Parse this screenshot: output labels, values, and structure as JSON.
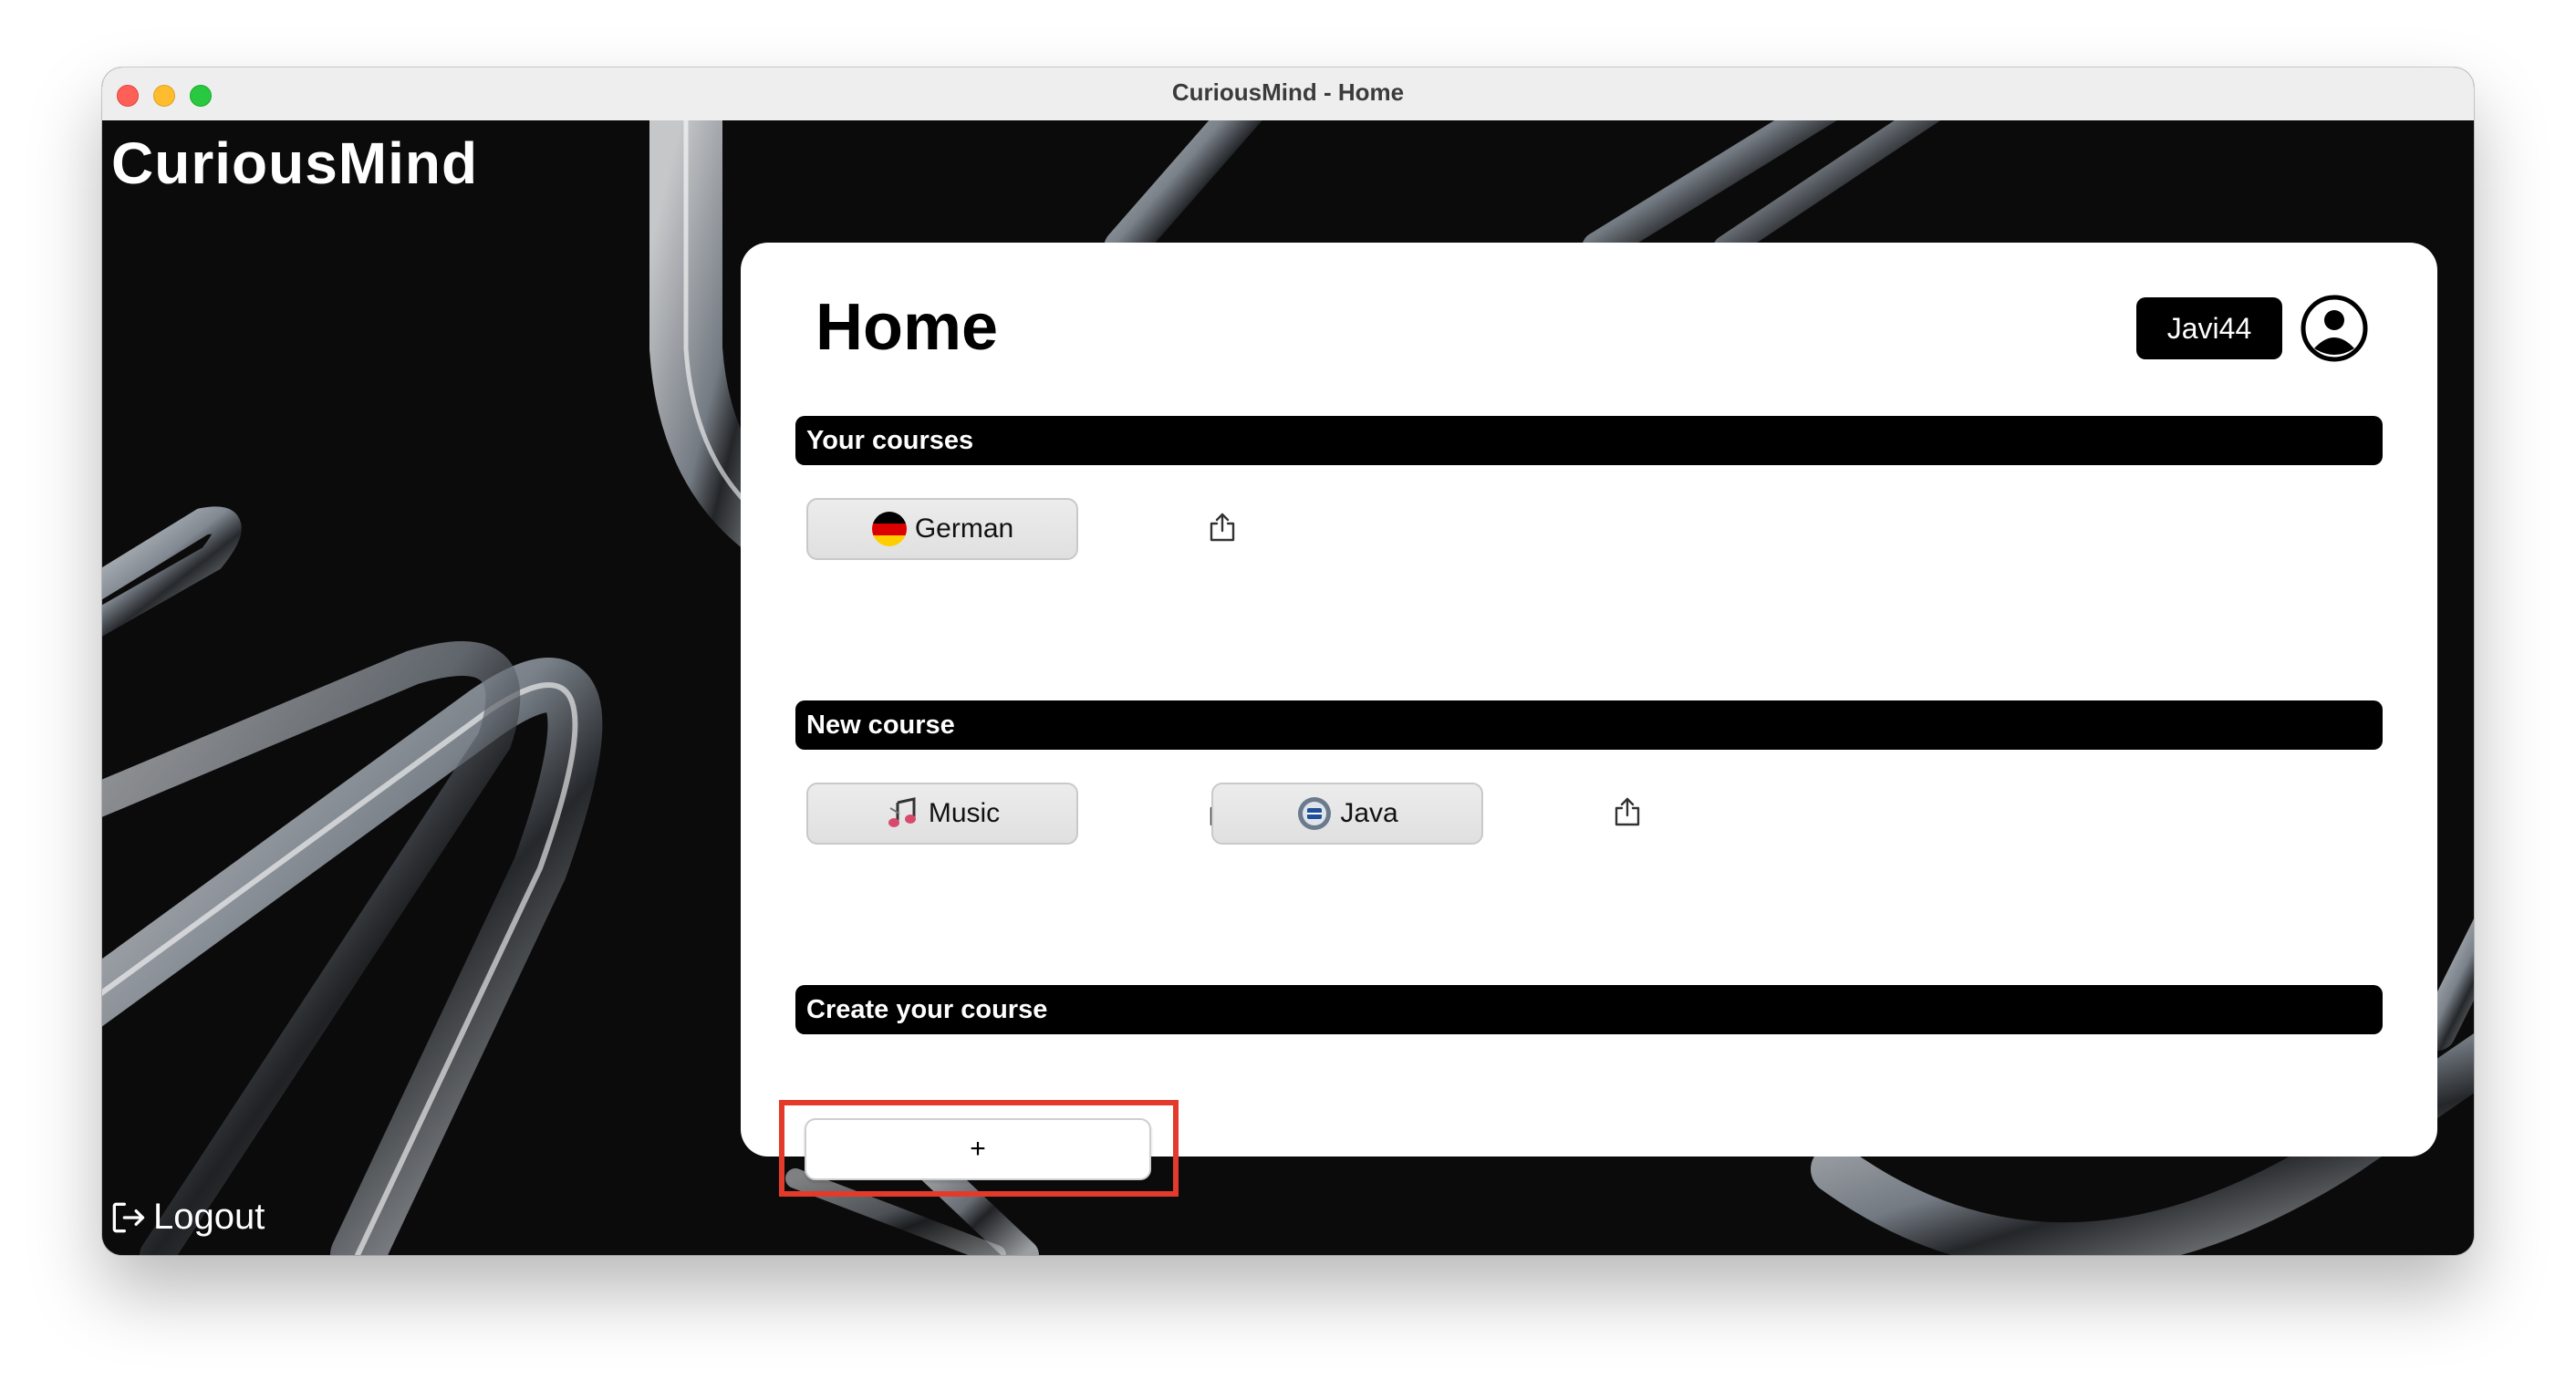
{
  "window": {
    "title": "CuriousMind - Home"
  },
  "brand": "CuriousMind",
  "logout": {
    "label": "Logout",
    "icon": "logout-icon"
  },
  "header": {
    "title": "Home",
    "username": "Javi44",
    "profile_icon": "user-circle-icon"
  },
  "sections": {
    "your_courses": {
      "title": "Your courses",
      "courses": [
        {
          "label": "German",
          "icon": "german-flag-icon"
        }
      ]
    },
    "new_course": {
      "title": "New course",
      "courses": [
        {
          "label": "Music",
          "icon": "music-notes-icon"
        },
        {
          "label": "Java",
          "icon": "java-logo-icon"
        }
      ]
    },
    "create_course": {
      "title": "Create your course",
      "add_label": "+"
    }
  },
  "colors": {
    "highlight": "#e43a2c",
    "bar": "#000000",
    "card": "#ffffff"
  }
}
